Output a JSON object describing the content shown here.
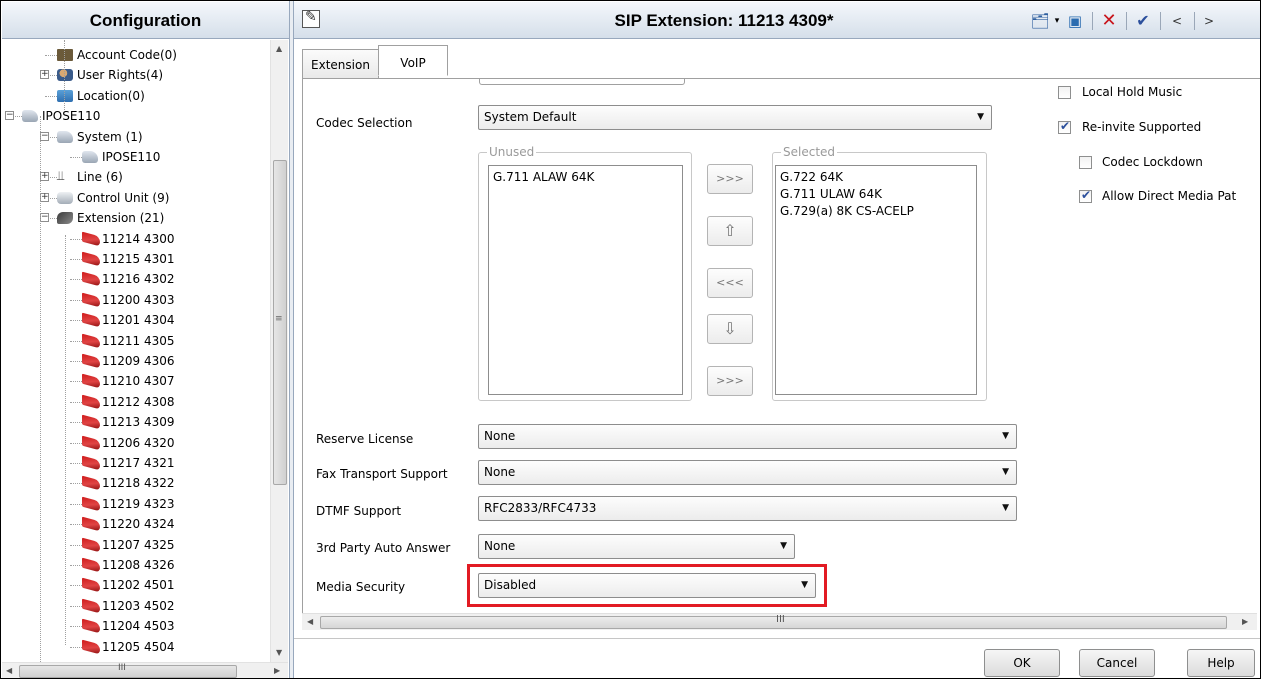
{
  "left_panel": {
    "title": "Configuration",
    "tree": [
      {
        "label": "Account Code(0)",
        "icon": "account-code-icon",
        "level": 1
      },
      {
        "label": "User Rights(4)",
        "icon": "user-rights-icon",
        "level": 1
      },
      {
        "label": "Location(0)",
        "icon": "location-icon",
        "level": 1
      },
      {
        "label": "IPOSE110",
        "icon": "system-icon",
        "level": 0
      },
      {
        "label": "System (1)",
        "icon": "system-icon",
        "level": 1
      },
      {
        "label": "IPOSE110",
        "icon": "system-icon",
        "level": 2
      },
      {
        "label": "Line (6)",
        "icon": "line-icon",
        "level": 1
      },
      {
        "label": "Control Unit (9)",
        "icon": "control-unit-icon",
        "level": 1
      },
      {
        "label": "Extension (21)",
        "icon": "extension-icon",
        "level": 1
      },
      {
        "label": "11214 4300",
        "icon": "sip-handset-icon",
        "level": 2
      },
      {
        "label": "11215 4301",
        "icon": "sip-handset-icon",
        "level": 2
      },
      {
        "label": "11216 4302",
        "icon": "sip-handset-icon",
        "level": 2
      },
      {
        "label": "11200 4303",
        "icon": "sip-handset-icon",
        "level": 2
      },
      {
        "label": "11201 4304",
        "icon": "sip-handset-icon",
        "level": 2
      },
      {
        "label": "11211 4305",
        "icon": "sip-handset-icon",
        "level": 2
      },
      {
        "label": "11209 4306",
        "icon": "sip-handset-icon",
        "level": 2
      },
      {
        "label": "11210 4307",
        "icon": "sip-handset-icon",
        "level": 2
      },
      {
        "label": "11212 4308",
        "icon": "sip-handset-icon",
        "level": 2
      },
      {
        "label": "11213 4309",
        "icon": "sip-handset-icon",
        "level": 2
      },
      {
        "label": "11206 4320",
        "icon": "sip-handset-icon",
        "level": 2
      },
      {
        "label": "11217 4321",
        "icon": "sip-handset-icon",
        "level": 2
      },
      {
        "label": "11218 4322",
        "icon": "sip-handset-icon",
        "level": 2
      },
      {
        "label": "11219 4323",
        "icon": "sip-handset-icon",
        "level": 2
      },
      {
        "label": "11220 4324",
        "icon": "sip-handset-icon",
        "level": 2
      },
      {
        "label": "11207 4325",
        "icon": "sip-handset-icon",
        "level": 2
      },
      {
        "label": "11208 4326",
        "icon": "sip-handset-icon",
        "level": 2
      },
      {
        "label": "11202 4501",
        "icon": "sip-handset-icon",
        "level": 2
      },
      {
        "label": "11203 4502",
        "icon": "sip-handset-icon",
        "level": 2
      },
      {
        "label": "11204 4503",
        "icon": "sip-handset-icon",
        "level": 2
      },
      {
        "label": "11205 4504",
        "icon": "sip-handset-icon",
        "level": 2
      }
    ],
    "hscroll_grip": "III"
  },
  "right_panel": {
    "title": "SIP Extension: 11213 4309*",
    "tabs": [
      "Extension",
      "VoIP"
    ],
    "active_tab": "VoIP",
    "codec_selection": {
      "label": "Codec Selection",
      "value": "System Default"
    },
    "unused": {
      "label": "Unused",
      "items": [
        "G.711 ALAW 64K"
      ]
    },
    "selected": {
      "label": "Selected",
      "items": [
        "G.722 64K",
        "G.711 ULAW 64K",
        "G.729(a) 8K CS-ACELP"
      ]
    },
    "move_buttons": [
      ">>>",
      "⇧",
      "<<<",
      "⇩",
      ">>>"
    ],
    "reserve_license": {
      "label": "Reserve License",
      "value": "None"
    },
    "fax_transport": {
      "label": "Fax Transport Support",
      "value": "None"
    },
    "dtmf_support": {
      "label": "DTMF Support",
      "value": "RFC2833/RFC4733"
    },
    "auto_answer": {
      "label": "3rd Party Auto Answer",
      "value": "None"
    },
    "media_security": {
      "label": "Media Security",
      "value": "Disabled"
    },
    "checkboxes": [
      {
        "label": "Local Hold Music",
        "checked": false
      },
      {
        "label": "Re-invite Supported",
        "checked": true
      },
      {
        "label": "Codec Lockdown",
        "checked": false
      },
      {
        "label": "Allow Direct Media Pat",
        "checked": true
      }
    ],
    "hscroll_grip": "III",
    "buttons": {
      "ok": "OK",
      "cancel": "Cancel",
      "help": "Help"
    },
    "colors": {
      "highlight": "#e21b23",
      "header_gradient_top": "#f4f7fb",
      "header_gradient_bottom": "#d5dfea"
    }
  }
}
